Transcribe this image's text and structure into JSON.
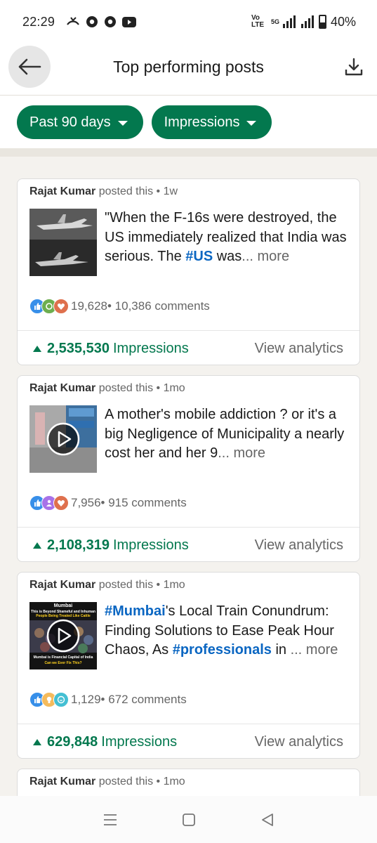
{
  "status_bar": {
    "time": "22:29",
    "network_label": "Vo LTE",
    "network_type": "5G",
    "battery": "40%"
  },
  "header": {
    "title": "Top performing posts"
  },
  "filters": {
    "period": "Past 90 days",
    "metric": "Impressions"
  },
  "posts": [
    {
      "author": "Rajat Kumar",
      "meta": " posted this • 1w",
      "text_before": "\"When the F-16s were destroyed, the US immediately realized that India was serious. The ",
      "hashtag1": "#US",
      "text_after": " was",
      "more": "... more",
      "reactions_count": "19,628",
      "comments": " • 10,386 comments",
      "impressions_value": "2,535,530",
      "impressions_label": "Impressions",
      "analytics_label": "View analytics",
      "thumb_type": "image"
    },
    {
      "author": "Rajat Kumar",
      "meta": " posted this • 1mo",
      "text_before": "A mother's mobile addiction ? or it's a big Negligence of Municipality a nearly cost her and her 9",
      "more": "... more",
      "reactions_count": "7,956",
      "comments": " • 915 comments",
      "impressions_value": "2,108,319",
      "impressions_label": "Impressions",
      "analytics_label": "View analytics",
      "thumb_type": "video"
    },
    {
      "author": "Rajat Kumar",
      "meta": " posted this • 1mo",
      "hashtag1": "#Mumbai",
      "text_mid": "'s Local Train Conundrum: Finding Solutions to Ease Peak Hour Chaos, As ",
      "hashtag2": "#professionals",
      "text_after": " in",
      "more": " ... more",
      "reactions_count": "1,129",
      "comments": " • 672 comments",
      "impressions_value": "629,848",
      "impressions_label": "Impressions",
      "analytics_label": "View analytics",
      "thumb_type": "video",
      "thumb_caption_top": "Mumbai",
      "thumb_caption_lines": [
        "This is Beyond Shameful and Inhuman",
        "People Being Treated Like Cattle"
      ],
      "thumb_caption_bottom": "Mumbai is Financial Capital of India",
      "thumb_caption_bottom2": "Can we Ever Fix This?"
    },
    {
      "author": "Rajat Kumar",
      "meta": " posted this • 1mo"
    }
  ],
  "colors": {
    "accent_green": "#03784e",
    "hashtag_blue": "#0a66c2"
  }
}
